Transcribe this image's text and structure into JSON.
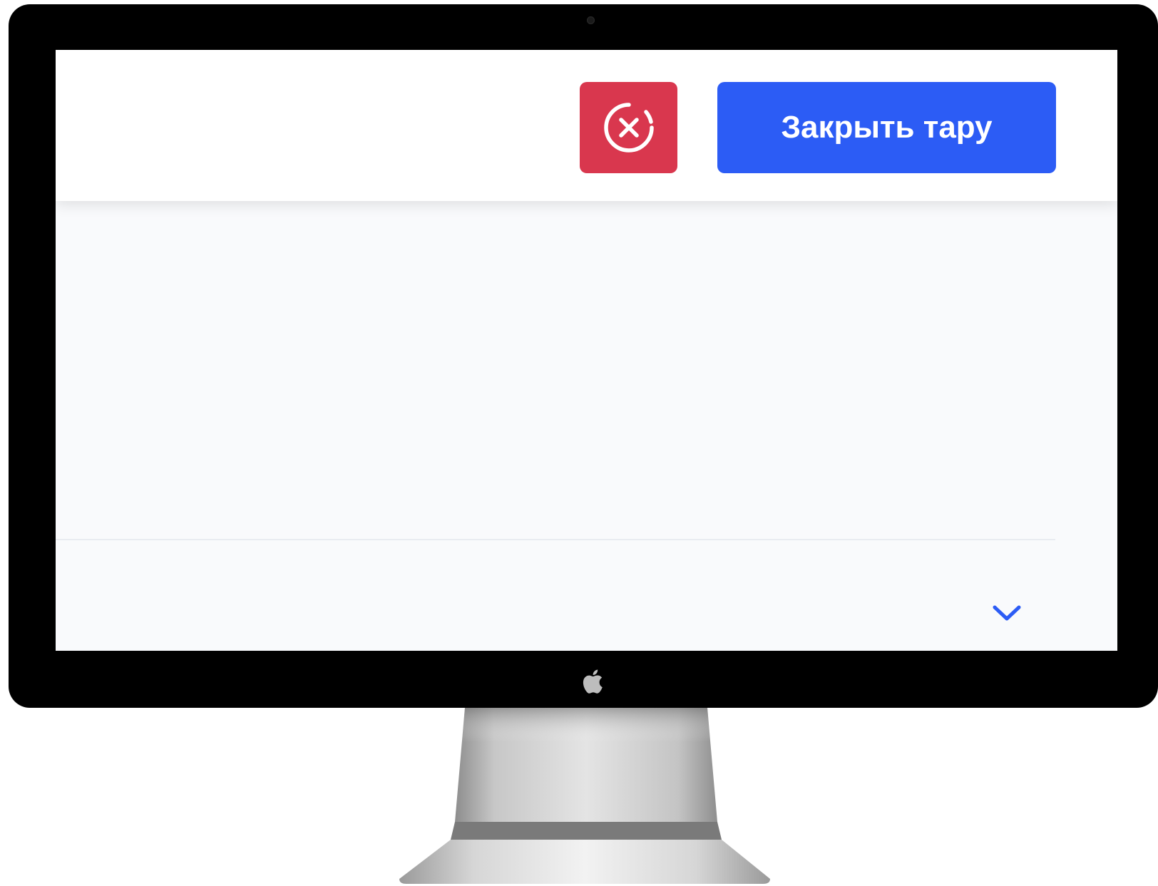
{
  "toolbar": {
    "close_tare_label": "Закрыть тару"
  },
  "icons": {
    "cancel": "close-circle-icon",
    "expand": "chevron-down-icon",
    "brand": "apple-logo-icon"
  },
  "colors": {
    "cancel_button": "#d9374e",
    "primary_button": "#2c5cf5",
    "chevron": "#2c5cf5",
    "screen_background": "#f9fafc"
  }
}
